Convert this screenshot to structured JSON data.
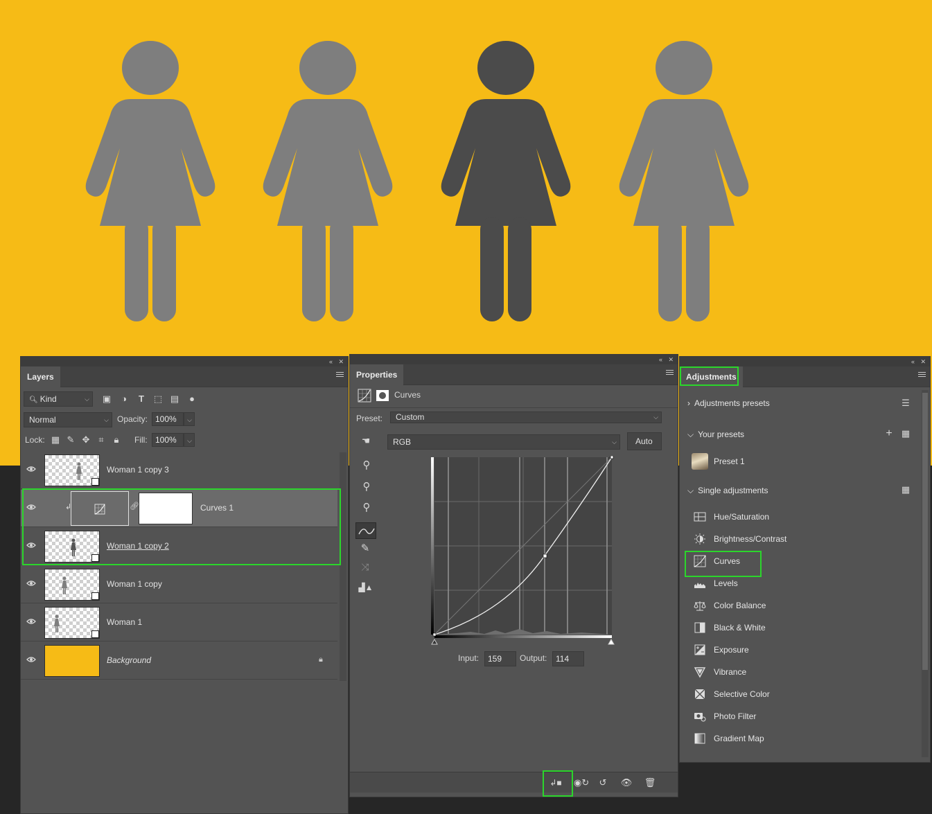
{
  "canvas": {
    "background_color": "#f6bb16",
    "figure_color": "#7e7e7e",
    "highlighted_figure_color": "#4b4b4b"
  },
  "layers_panel": {
    "tab_label": "Layers",
    "filter_kind": "Kind",
    "blend_mode": "Normal",
    "opacity_label": "Opacity:",
    "opacity_value": "100%",
    "lock_label": "Lock:",
    "fill_label": "Fill:",
    "fill_value": "100%",
    "layers": [
      {
        "name": "Woman 1 copy 3"
      },
      {
        "name": "Curves 1"
      },
      {
        "name": "Woman 1 copy 2"
      },
      {
        "name": "Woman 1 copy"
      },
      {
        "name": "Woman 1"
      },
      {
        "name": "Background"
      }
    ]
  },
  "properties_panel": {
    "tab_label": "Properties",
    "adjustment_name": "Curves",
    "preset_label": "Preset:",
    "preset_value": "Custom",
    "channel_value": "RGB",
    "auto_label": "Auto",
    "input_label": "Input:",
    "input_value": "159",
    "output_label": "Output:",
    "output_value": "114",
    "curve_point": {
      "input": 159,
      "output": 114
    }
  },
  "adjustments_panel": {
    "tab_label": "Adjustments",
    "presets_section": "Adjustments presets",
    "your_presets_section": "Your presets",
    "preset_item": "Preset 1",
    "single_section": "Single adjustments",
    "items": [
      {
        "label": "Hue/Saturation",
        "icon": "hue-saturation-icon"
      },
      {
        "label": "Brightness/Contrast",
        "icon": "brightness-contrast-icon"
      },
      {
        "label": "Curves",
        "icon": "curves-icon"
      },
      {
        "label": "Levels",
        "icon": "levels-icon"
      },
      {
        "label": "Color Balance",
        "icon": "color-balance-icon"
      },
      {
        "label": "Black & White",
        "icon": "black-white-icon"
      },
      {
        "label": "Exposure",
        "icon": "exposure-icon"
      },
      {
        "label": "Vibrance",
        "icon": "vibrance-icon"
      },
      {
        "label": "Selective Color",
        "icon": "selective-color-icon"
      },
      {
        "label": "Photo Filter",
        "icon": "photo-filter-icon"
      },
      {
        "label": "Gradient Map",
        "icon": "gradient-map-icon"
      }
    ]
  },
  "highlight_color": "#2bd62b"
}
